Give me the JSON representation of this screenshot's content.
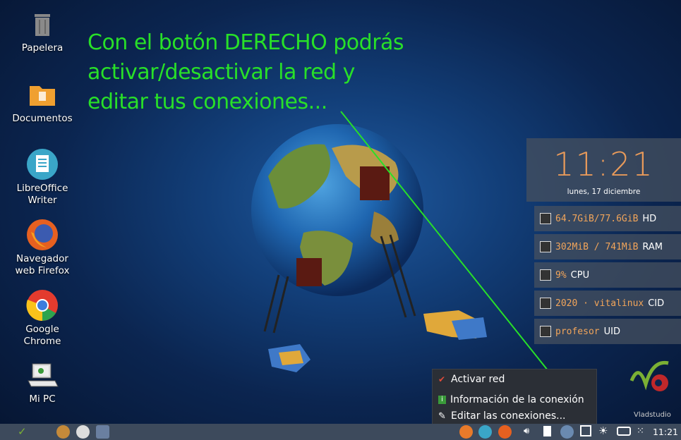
{
  "desktop": {
    "icons": [
      {
        "label": "Papelera"
      },
      {
        "label": "Documentos"
      },
      {
        "label": "LibreOffice\nWriter"
      },
      {
        "label": "Navegador\nweb Firefox"
      },
      {
        "label": "Google\nChrome"
      },
      {
        "label": "Mi PC"
      }
    ]
  },
  "annotation": {
    "line1": "Con el botón DERECHO podrás",
    "line2": "activar/desactivar la red y",
    "line3": "editar tus conexiones..."
  },
  "conky": {
    "time": "11:21",
    "date": "lunes, 17 diciembre",
    "stats": [
      {
        "icon": "hdd-icon",
        "value": "64.7GiB/77.6GiB",
        "label": "HD"
      },
      {
        "icon": "ram-icon",
        "value": "302MiB / 741MiB",
        "label": "RAM"
      },
      {
        "icon": "cpu-icon",
        "value": "9%",
        "label": "CPU"
      },
      {
        "icon": "cid-icon",
        "value": "2020 · vitalinux",
        "label": "CID"
      },
      {
        "icon": "user-icon",
        "value": "profesor",
        "label": "UID"
      }
    ]
  },
  "context_menu": {
    "items": [
      {
        "label": "Activar red",
        "checked": true
      },
      {
        "label": "Información de la conexión"
      },
      {
        "label": "Editar las conexiones..."
      }
    ]
  },
  "watermark": {
    "text": "Vladstudio"
  },
  "taskbar": {
    "clock": "11:21"
  },
  "colors": {
    "annotation": "#28e028",
    "accent": "#f2a55a",
    "taskbar": "#3d4a5c"
  }
}
